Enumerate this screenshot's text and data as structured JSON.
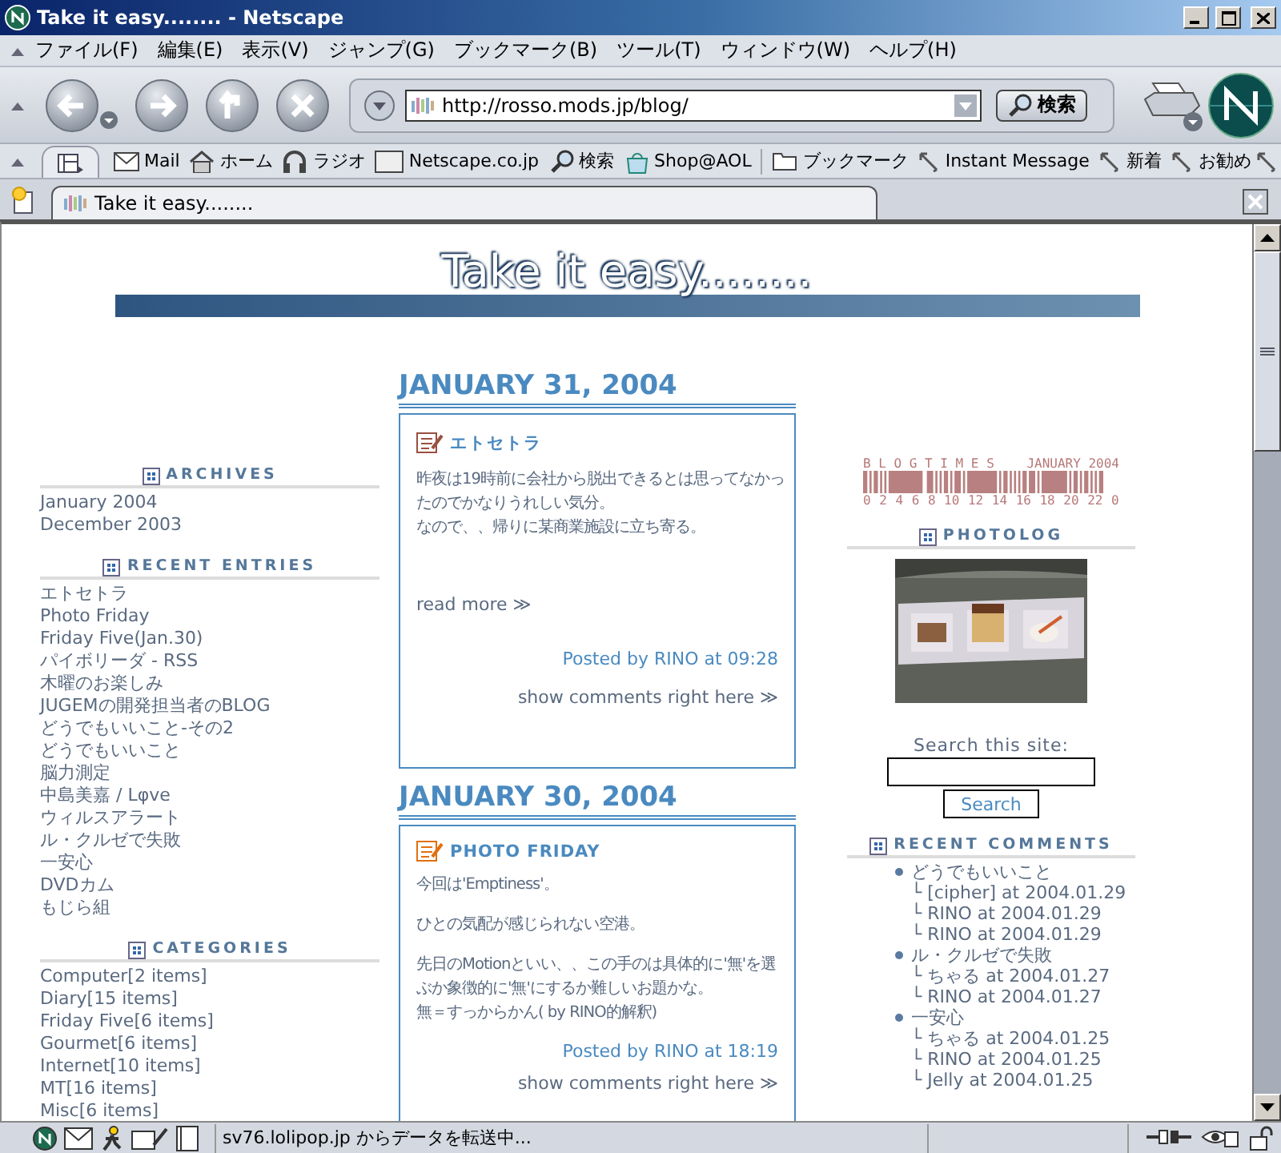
{
  "window": {
    "title": "Take it easy........ - Netscape"
  },
  "menu": [
    "ファイル(F)",
    "編集(E)",
    "表示(V)",
    "ジャンプ(G)",
    "ブックマーク(B)",
    "ツール(T)",
    "ウィンドウ(W)",
    "ヘルプ(H)"
  ],
  "navigation": {
    "url": "http://rosso.mods.jp/blog/",
    "search_button": "検索"
  },
  "bookmarks": [
    {
      "kind": "mail",
      "label": "Mail"
    },
    {
      "kind": "home",
      "label": "ホーム"
    },
    {
      "kind": "radio",
      "label": "ラジオ"
    },
    {
      "kind": "my",
      "label": "Netscape.co.jp"
    },
    {
      "kind": "search",
      "label": "検索"
    },
    {
      "kind": "shop",
      "label": "Shop@AOL"
    },
    {
      "kind": "folder",
      "label": "ブックマーク"
    },
    {
      "kind": "link",
      "label": "Instant Message"
    },
    {
      "kind": "link",
      "label": "新着"
    },
    {
      "kind": "link",
      "label": "お勧め"
    }
  ],
  "tab": {
    "label": "Take it easy........"
  },
  "blog": {
    "title": "Take it easy........",
    "left_sections": [
      {
        "heading": "ARCHIVES",
        "items": [
          "January 2004",
          "December 2003"
        ]
      },
      {
        "heading": "RECENT ENTRIES",
        "items": [
          "エトセトラ",
          "Photo Friday",
          "Friday Five(Jan.30)",
          "パイボリーダ - RSS",
          "木曜のお楽しみ",
          "JUGEMの開発担当者のBLOG",
          "どうでもいいこと-その2",
          "どうでもいいこと",
          "脳力測定",
          "中島美嘉 / Lφve",
          "ウィルスアラート",
          "ル・クルゼで失敗",
          "一安心",
          "DVDカム",
          "もじら組"
        ]
      },
      {
        "heading": "CATEGORIES",
        "items": [
          "Computer[2 items]",
          "Diary[15 items]",
          "Friday Five[6 items]",
          "Gourmet[6 items]",
          "Internet[10 items]",
          "MT[16 items]",
          "Misc[6 items]"
        ]
      }
    ],
    "posts": [
      {
        "date": "JANUARY 31, 2004",
        "title": "エトセトラ",
        "color": "#9a5040",
        "paragraphs": [
          [
            "昨夜は19時前に会社から脱出できるとは思ってなかったのでかなりうれしい気分。",
            "なので、、帰りに某商業施設に立ち寄る。"
          ]
        ],
        "read_more": "read more ≫",
        "posted": "Posted by RINO at 09:28",
        "comments": "show comments right here ≫"
      },
      {
        "date": "JANUARY 30, 2004",
        "title": "PHOTO FRIDAY",
        "color": "#e07010",
        "paragraphs": [
          [
            "今回は'Emptiness'。"
          ],
          [
            "ひとの気配が感じられない空港。"
          ],
          [
            "先日のMotionといい、、この手のは具体的に'無'を選ぶか象徴的に'無'にするか難しいお題かな。",
            "無＝すっからかん( by RINO的解釈)"
          ]
        ],
        "posted": "Posted by RINO at 18:19",
        "comments": "show comments right here ≫"
      }
    ],
    "blogtimes": {
      "title": "B L O G T I M E S",
      "month": "JANUARY 2004",
      "ticks": [
        "0",
        "2",
        "4",
        "6",
        "8",
        "10",
        "12",
        "14",
        "16",
        "18",
        "20",
        "22",
        "0"
      ]
    },
    "photolog": {
      "heading": "PHOTOLOG"
    },
    "search": {
      "label": "Search this site:",
      "button": "Search"
    },
    "recent_comments": {
      "heading": "RECENT COMMENTS",
      "items": [
        {
          "title": "どうでもいいこと",
          "children": [
            "└ [cipher] at 2004.01.29",
            "└ RINO at 2004.01.29",
            "└ RINO at 2004.01.29"
          ]
        },
        {
          "title": "ル・クルゼで失敗",
          "children": [
            "└ ちゃる at 2004.01.27",
            "└ RINO at 2004.01.27"
          ]
        },
        {
          "title": "一安心",
          "children": [
            "└ ちゃる at 2004.01.25",
            "└ RINO at 2004.01.25",
            "└ Jelly at 2004.01.25"
          ]
        }
      ]
    }
  },
  "status_bar": {
    "text": "sv76.lolipop.jp からデータを転送中..."
  }
}
